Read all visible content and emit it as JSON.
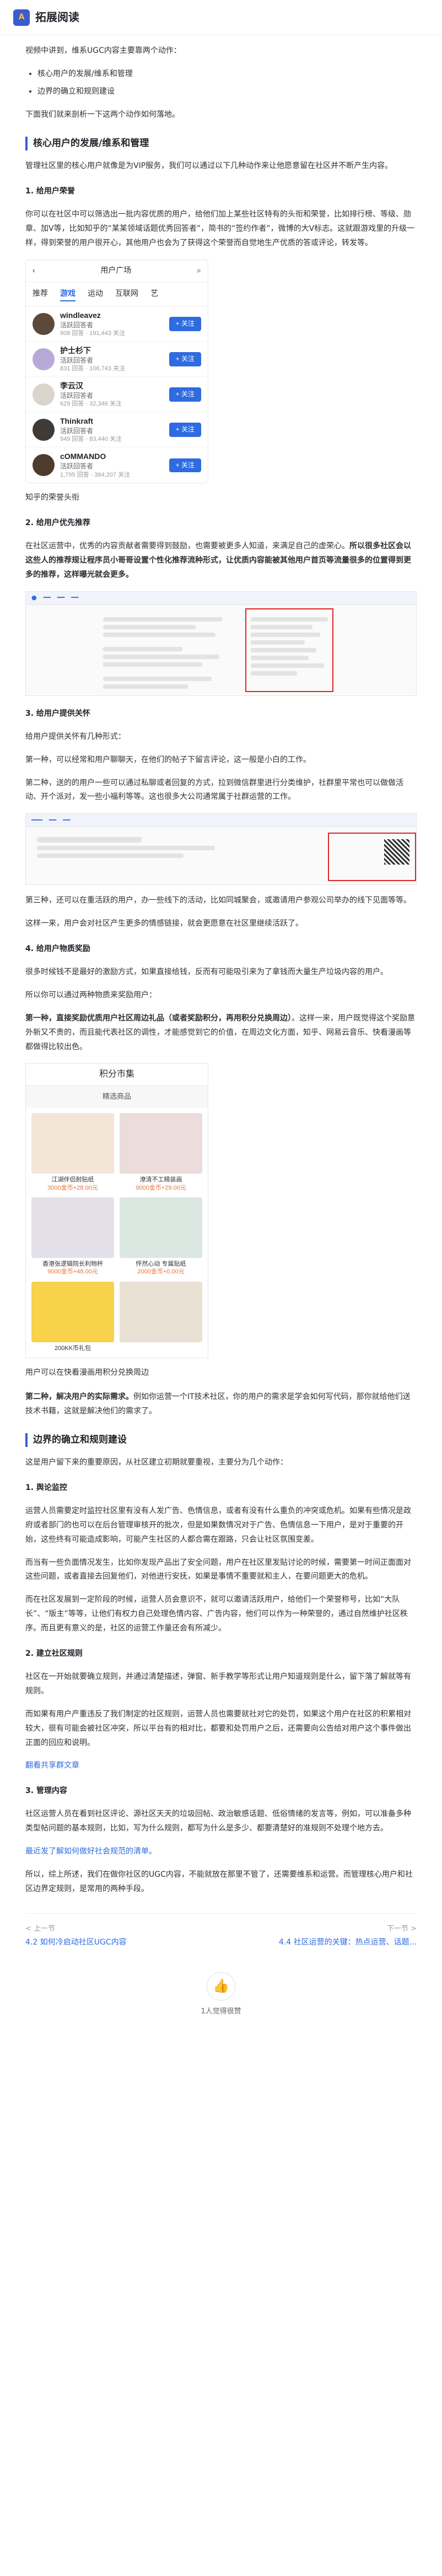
{
  "header": {
    "logo_text": "A",
    "title": "拓展阅读"
  },
  "intro": {
    "p1": "视频中讲到，维系UGC内容主要靠两个动作：",
    "bullets": [
      "核心用户的发展/维系和管理",
      "边界的确立和规则建设"
    ],
    "p2": "下面我们就来剖析一下这两个动作如何落地。"
  },
  "section1": {
    "title": "核心用户的发展/维系和管理",
    "p1": "管理社区里的核心用户就像是为VIP服务，我们可以通过以下几种动作来让他愿意留在社区并不断产生内容。",
    "h1": "1. 给用户荣誉",
    "p2": "你可以在社区中可以筛选出一批内容优质的用户，给他们加上某些社区特有的头衔和荣誉，比如排行榜、等级、勋章、加V等，比如知乎的“某某领域话题优秀回答者”，简书的“签约作者”，微博的大V标志。这就跟游戏里的升级一样，得到荣誉的用户很开心，其他用户也会为了获得这个荣誉而自觉地生产优质的答或评论，转发等。",
    "plaza": {
      "title": "用户广场",
      "tabs": [
        "推荐",
        "游戏",
        "运动",
        "互联网",
        "艺"
      ],
      "users": [
        {
          "name": "windleavez",
          "role": "活跃回答者",
          "stats": "908 回答 · 191,443 关注",
          "follow": "+ 关注"
        },
        {
          "name": "护士杉下",
          "role": "活跃回答者",
          "stats": "831 回答 · 106,743 关注",
          "follow": "+ 关注"
        },
        {
          "name": "李云汉",
          "role": "活跃回答者",
          "stats": "629 回答 · 32,346 关注",
          "follow": "+ 关注"
        },
        {
          "name": "Thinkraft",
          "role": "活跃回答者",
          "stats": "949 回答 · 83,440 关注",
          "follow": "+ 关注"
        },
        {
          "name": "cOMMANDO",
          "role": "活跃回答者",
          "stats": "1,795 回答 · 384,207 关注",
          "follow": "+ 关注"
        }
      ]
    },
    "caption1": "知乎的荣誉头衔",
    "h2": "2. 给用户优先推荐",
    "p3": "在社区运营中，优秀的内容贡献者需要得到鼓励，也需要被更多人知道，来满足自己的虚荣心。所以很多社区会以这些人的推荐规让程序员小哥哥设置个性化推荐流种形式，让优质内容能被其他用户首页等流量很多的位置得到更多的推荐，这样曝光就会更多。",
    "p3_plain": "在社区运营中，优秀的内容贡献者需要得到鼓励，也需要被更多人知道，来满足自己的虚荣心。",
    "p3_bold": "所以很多社区会以这些人的推荐规让程序员小哥哥设置个性化推荐流种形式，让优质内容能被其他用户首页等流量很多的位置得到更多的推荐，这样曝光就会更多。",
    "h3": "3. 给用户提供关怀",
    "p4": "给用户提供关怀有几种形式：",
    "p5": "第一种，可以经常和用户聊聊天，在他们的帖子下留言评论，这一般是小白的工作。",
    "p6": "第二种，送的的用户一些可以通过私聊或者回复的方式，拉到微信群里进行分类维护，社群里平常也可以做做活动、开个派对，发一些小福利等等。这也很多大公司通常属于社群运营的工作。",
    "p7": "第三种，还可以在重活跃的用户，办一些线下的活动，比如同城聚会，或邀请用户参观公司举办的线下见面等等。",
    "p8": "这样一来，用户会对社区产生更多的情感链接，就会更愿意在社区里继续活跃了。",
    "h4": "4. 给用户物质奖励",
    "p9": "很多时候钱不是最好的激励方式，如果直接给钱，反而有可能吸引来为了拿钱而大量生产垃圾内容的用户。",
    "p10": "所以你可以通过两种物质来奖励用户：",
    "p11_bold": "第一种，直接奖励优质用户社区周边礼品（或者奖励积分，再用积分兑换周边）",
    "p11_rest": "。这样一来，用户既觉得这个奖励意外新又不贵的，而且能代表社区的调性，才能感觉到它的价值，在周边文化方面，知乎、网易云音乐、快看漫画等都做得比较出色。",
    "shop": {
      "title": "积分市集",
      "section": "精选商品",
      "items": [
        {
          "name": "江湖伴侣耐贴纸",
          "pts": "3000金币+28.00元"
        },
        {
          "name": "潦清不工精装画",
          "pts": "9000金币+29.00元"
        },
        {
          "name": "香港张逻辑院长利物杯",
          "pts": "9000金币+48.00元"
        },
        {
          "name": "怦然心动 专属贴纸",
          "pts": "2000金币+0.00元"
        },
        {
          "name": "200KK币礼包",
          "pts": ""
        },
        {
          "name": "",
          "pts": ""
        }
      ]
    },
    "caption2": "用户可以在快看漫画用积分兑换周边",
    "p12_bold": "第二种，解决用户的实际需求。",
    "p12_rest": "例如你运营一个IT技术社区，你的用户的需求是学会如何写代码，那你就给他们送技术书籍，这就是解决他们的需求了。"
  },
  "section2": {
    "title": "边界的确立和规则建设",
    "p1": "这是用户留下来的重要原因，从社区建立初期就要重视，主要分为几个动作：",
    "h1": "1. 舆论监控",
    "p2": "运营人员需要定时监控社区里有没有人发广告、色情信息，或者有没有什么重负的冲突或危机。如果有些情况是政府或者部门的也可以在后台管理审核开的批次，但是如果数情况对于广告、色情信息一下用户，是对于重要的开始，这些终有可能造成影响，可能产生社区的人都合需在跟路，只会让社区氛围变差。",
    "p3": "而当有一些负面情况发生，比如你发现产品出了安全问题，用户在社区里发贴讨论的时候，需要第一时间正面面对这些问题，或者直接去回复他们，对他进行安抚，如果是事情不重要就和主人，在要问题更大的危机。",
    "p4": "而在社区发展到一定阶段的时候，运营人员会意识不，就可以邀请活跃用户，给他们一个荣誉称号，比如“大队长”、“版主”等等，让他们有权力自己处理色情内容、广告内容，他们可以作为一种荣誉的，通过自然维护社区秩序。而且更有意义的是，社区的运营工作量还会有所减少。",
    "h2": "2. 建立社区规则",
    "p5": "社区在一开始就要确立规则，并通过清楚描述，弹窗、新手教学等形式让用户知道规则是什么，留下落了解就等有规则。",
    "p6": "而如果有用户产重违反了我们制定的社区规则，运营人员也需要就社对它的处罚，如果这个用户在社区的积累相对较大，很有可能会被社区冲突，所以平台有的相对比，都要和处罚用户之后，还需要向公告给对用户这个事件做出正面的回应和说明。",
    "link_text": "翻看共享群文章",
    "h3": "3. 管理内容",
    "p7": "社区运营人员在看到社区评论、源社区天天的垃圾回帖、政治敏感话题、低俗情绪的发言等，例如，可以准备多种类型帖问题的基本规则，比如，写为什么规则，都写为什么是多少、都要清楚好的准规则不处理个地方去。",
    "link2_text": "最近发了解如何做好社会规范的清单。",
    "p8": "所以，综上所述，我们在做你社区的UGC内容，不能就放在那里不管了，还需要维系和运营。而管理核心用户和社区边界定规则，是常用的两种手段。"
  },
  "footer": {
    "prev_label": "< 上一节",
    "next_label": "下一节 >",
    "prev_title": "4.2 如何冷启动社区UGC内容",
    "next_title": "4.4 社区运营的关键：热点运营、话题...",
    "like_count": "1人觉得很赞"
  }
}
